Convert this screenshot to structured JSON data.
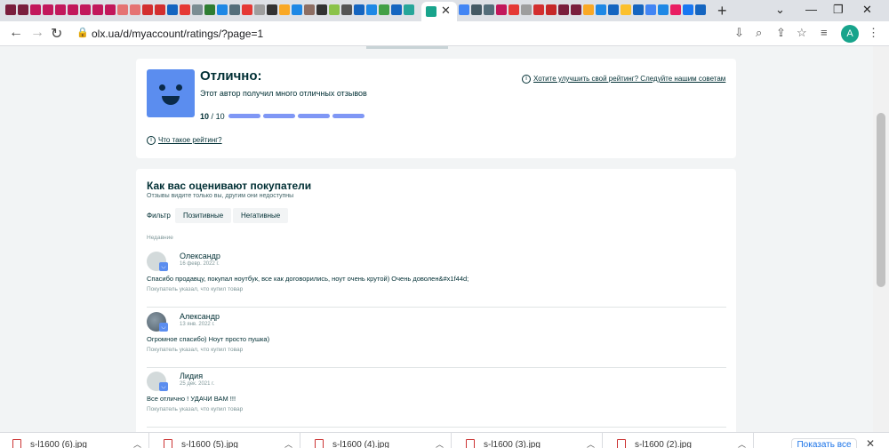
{
  "browser": {
    "url": "olx.ua/d/myaccount/ratings/?page=1",
    "profile_initial": "A",
    "new_tab_glyph": "+",
    "close_glyph": "✕"
  },
  "rating_card": {
    "title": "Отлично:",
    "description": "Этот автор получил много отличных отзывов",
    "score_value": "10",
    "score_sep": "/",
    "score_max": "10",
    "improve_link": "Хотите улучшить свой рейтинг? Следуйте нашим советам",
    "what_is_link": "Что такое рейтинг?",
    "face_color": "#5b8def",
    "bar_color": "#7f97f5"
  },
  "reviews_card": {
    "title": "Как вас оценивают покупатели",
    "subtitle": "Отзывы видите только вы, другим они недоступны",
    "filter_label": "Фильтр",
    "filters": [
      "Позитивные",
      "Негативные"
    ],
    "recent_label": "Недавние",
    "reviews": [
      {
        "name": "Олександр",
        "date": "16 февр. 2022 г.",
        "text": "Спасибо продавцу, покупал ноутбук, все как договорились, ноут очень крутой) Очень доволен&#x1f44d;",
        "note": "Покупатель указал, что купил товар"
      },
      {
        "name": "Александр",
        "date": "13 янв. 2022 г.",
        "text": "Огромное спасибо) Ноут просто пушка)",
        "note": "Покупатель указал, что купил товар"
      },
      {
        "name": "Лидия",
        "date": "25 дек. 2021 г.",
        "text": "Все отлично ! УДАЧИ ВАМ !!!",
        "note": "Покупатель указал, что купил товар"
      }
    ]
  },
  "downloads": {
    "items": [
      "s-l1600 (6).jpg",
      "s-l1600 (5).jpg",
      "s-l1600 (4).jpg",
      "s-l1600 (3).jpg",
      "s-l1600 (2).jpg"
    ],
    "show_all": "Показать все"
  }
}
